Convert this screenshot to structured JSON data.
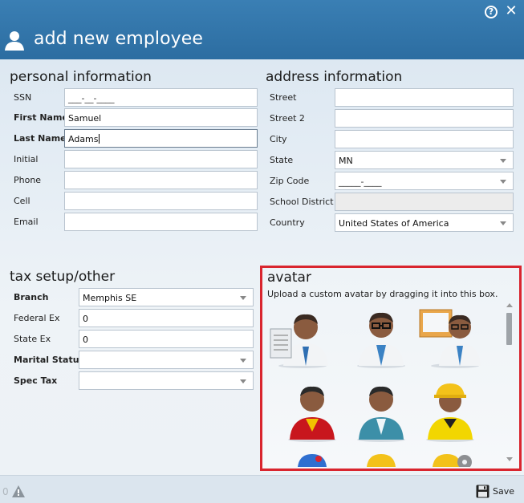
{
  "window": {
    "title": "add new employee",
    "help_label": "?",
    "close_label": "✕",
    "title_icon": "person-icon"
  },
  "personal": {
    "heading": "personal information",
    "fields": [
      {
        "label": "SSN",
        "value": "___-__-____",
        "bold": false
      },
      {
        "label": "First Name",
        "value": "Samuel",
        "bold": true
      },
      {
        "label": "Last Name",
        "value": "Adams",
        "bold": true
      },
      {
        "label": "Initial",
        "value": "",
        "bold": false
      },
      {
        "label": "Phone",
        "value": "",
        "bold": false
      },
      {
        "label": "Cell",
        "value": "",
        "bold": false
      },
      {
        "label": "Email",
        "value": "",
        "bold": false
      }
    ]
  },
  "address": {
    "heading": "address information",
    "fields": [
      {
        "label": "Street",
        "value": ""
      },
      {
        "label": "Street 2",
        "value": ""
      },
      {
        "label": "City",
        "value": ""
      },
      {
        "label": "State",
        "value": "MN"
      },
      {
        "label": "Zip Code",
        "value": "_____-____"
      },
      {
        "label": "School District",
        "value": ""
      },
      {
        "label": "Country",
        "value": "United States of America"
      }
    ]
  },
  "tax": {
    "heading": "tax setup/other",
    "fields": [
      {
        "label": "Branch",
        "value": "Memphis SE",
        "bold": true
      },
      {
        "label": "Federal Ex",
        "value": "0",
        "bold": false
      },
      {
        "label": "State Ex",
        "value": "0",
        "bold": false
      },
      {
        "label": "Marital Status",
        "value": "",
        "bold": true
      },
      {
        "label": "Spec Tax",
        "value": "",
        "bold": true
      }
    ]
  },
  "avatar": {
    "heading": "avatar",
    "hint": "Upload a custom avatar by dragging it into this box.",
    "options": [
      "avatar-clipboard-icon",
      "avatar-glasses-icon",
      "avatar-presenter-icon",
      "avatar-red-shirt-icon",
      "avatar-teal-shirt-icon",
      "avatar-hardhat-yellow-icon"
    ]
  },
  "footer": {
    "warning_count": "0",
    "save_label": "Save"
  },
  "colors": {
    "titlebar": "#2c6da1",
    "highlight_border": "#d9252e"
  }
}
